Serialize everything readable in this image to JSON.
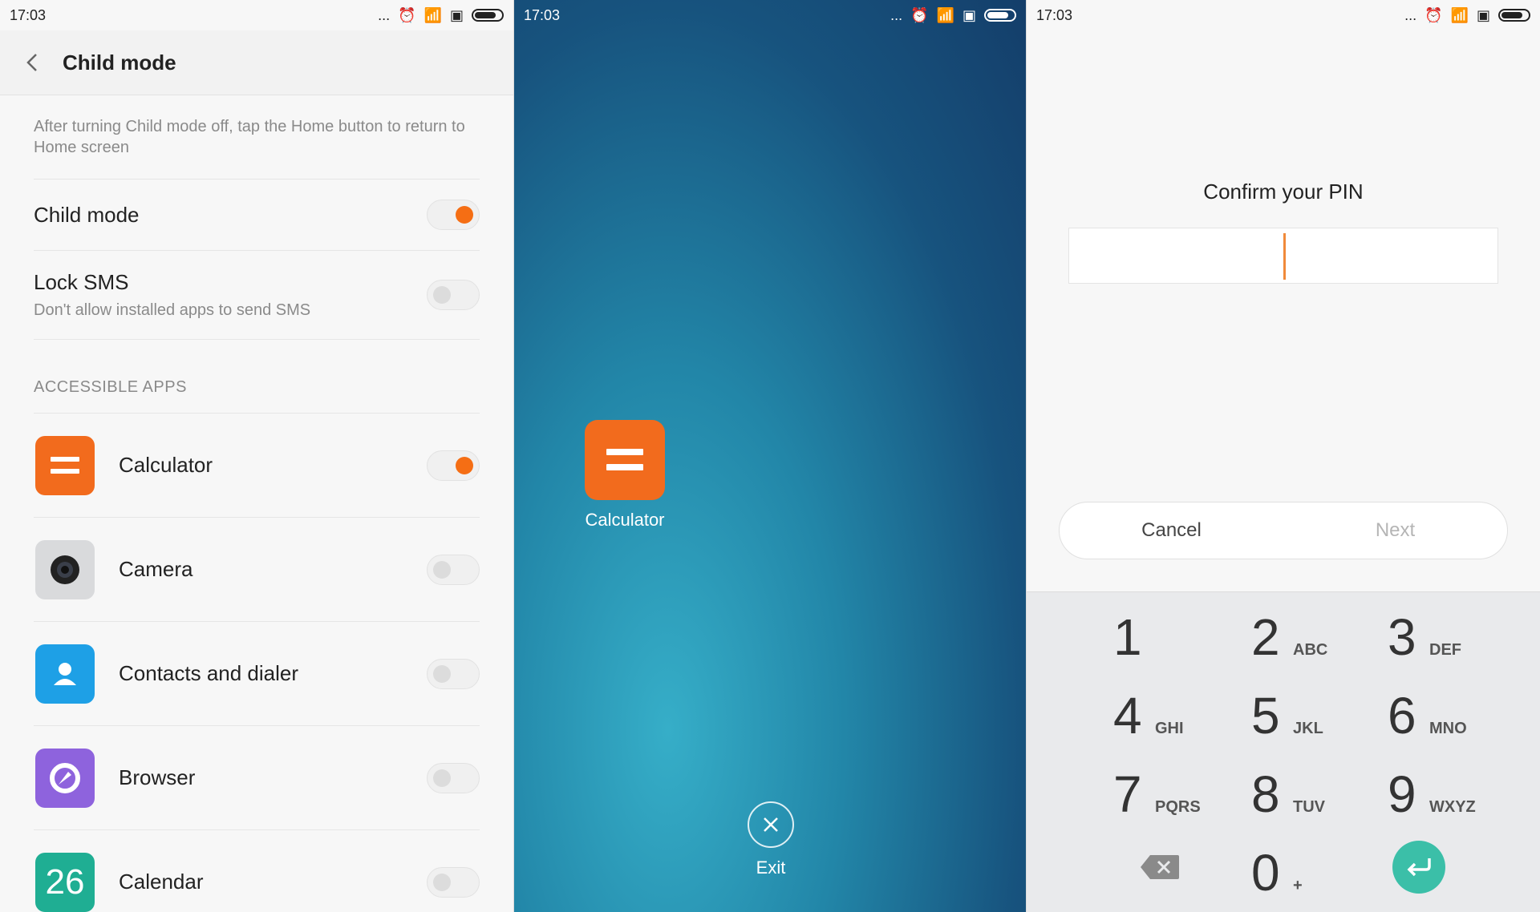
{
  "status": {
    "time": "17:03",
    "dots": "..."
  },
  "child_mode": {
    "title": "Child mode",
    "note": "After turning Child mode off, tap the Home button to return to Home screen",
    "toggle_row": {
      "label": "Child mode",
      "state": "on"
    },
    "lock_sms": {
      "label": "Lock SMS",
      "sub": "Don't allow installed apps to send SMS",
      "state": "off"
    },
    "section_header": "ACCESSIBLE APPS",
    "apps": [
      {
        "label": "Calculator",
        "icon": "calculator-icon",
        "color": "#f26b1d",
        "state": "on"
      },
      {
        "label": "Camera",
        "icon": "camera-icon",
        "color": "#d9dadc",
        "state": "off"
      },
      {
        "label": "Contacts and dialer",
        "icon": "contacts-icon",
        "color": "#1ea0e6",
        "state": "off"
      },
      {
        "label": "Browser",
        "icon": "browser-icon",
        "color": "#8e63dd",
        "state": "off"
      },
      {
        "label": "Calendar",
        "icon": "calendar-icon",
        "color": "#1fae93",
        "state": "off",
        "day": "26"
      }
    ]
  },
  "home": {
    "app_label": "Calculator",
    "exit_label": "Exit"
  },
  "pin": {
    "title": "Confirm your PIN",
    "cancel": "Cancel",
    "next": "Next",
    "keys": [
      {
        "digit": "1",
        "letters": ""
      },
      {
        "digit": "2",
        "letters": "ABC"
      },
      {
        "digit": "3",
        "letters": "DEF"
      },
      {
        "digit": "4",
        "letters": "GHI"
      },
      {
        "digit": "5",
        "letters": "JKL"
      },
      {
        "digit": "6",
        "letters": "MNO"
      },
      {
        "digit": "7",
        "letters": "PQRS"
      },
      {
        "digit": "8",
        "letters": "TUV"
      },
      {
        "digit": "9",
        "letters": "WXYZ"
      },
      {
        "digit": "0",
        "letters": "+"
      }
    ]
  },
  "colors": {
    "accent": "#f56e14",
    "enter": "#3bbfa8"
  }
}
